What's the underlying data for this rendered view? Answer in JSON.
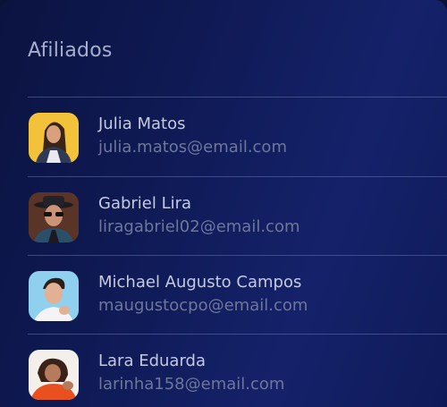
{
  "header": {
    "title": "Afiliados"
  },
  "affiliates": [
    {
      "name": "Julia Matos",
      "email": "julia.matos@email.com"
    },
    {
      "name": "Gabriel Lira",
      "email": "liragabriel02@email.com"
    },
    {
      "name": "Michael Augusto Campos",
      "email": "maugustocpo@email.com"
    },
    {
      "name": "Lara Eduarda",
      "email": "larinha158@email.com"
    }
  ],
  "colors": {
    "background": "#101c5a",
    "title_text": "#a7afcd",
    "name_text": "#c4cadf",
    "email_text": "#6e7799"
  }
}
